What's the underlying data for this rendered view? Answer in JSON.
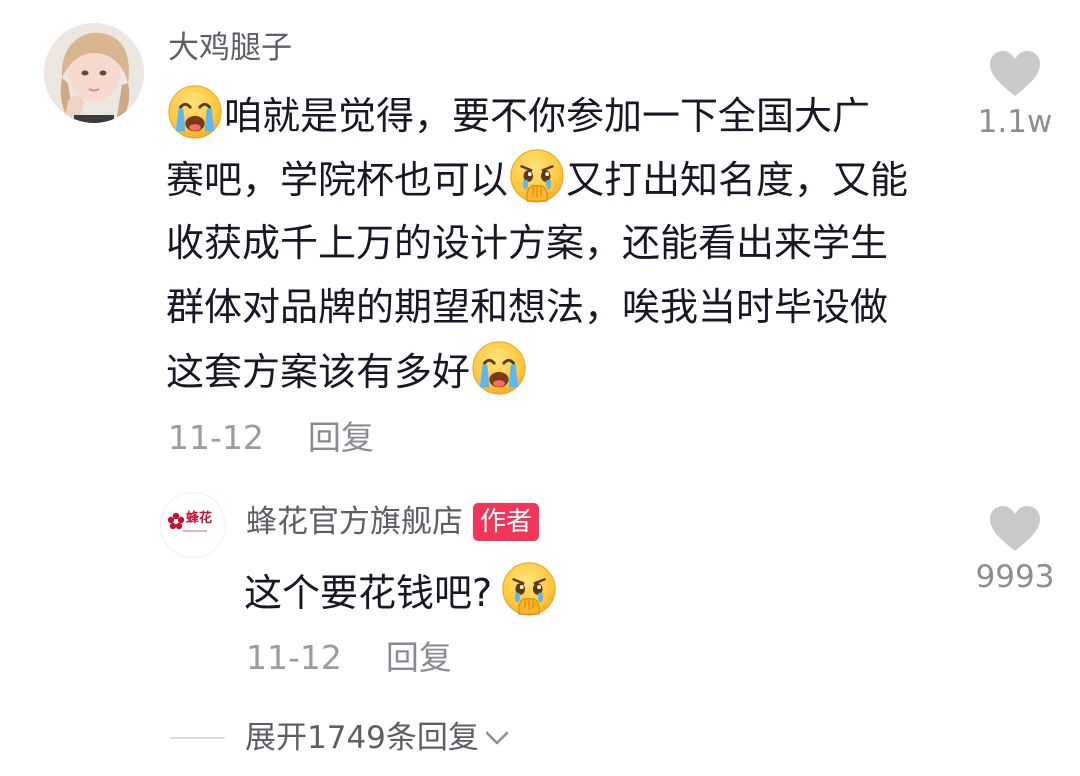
{
  "main_comment": {
    "username": "大鸡腿子",
    "lines": [
      "咱就是觉得，要不你参加一下全国大广",
      "赛吧，学院杯也可以",
      "又打出知名度，又能",
      "收获成千上万的设计方案，还能看出来学生",
      "群体对品牌的期望和想法，唉我当时毕设做",
      "这套方案该有多好"
    ],
    "date": "11-12",
    "reply_label": "回复",
    "like_count": "1.1w",
    "emojis": [
      "crying-face-emoji",
      "holding-back-tears-emoji",
      "crying-face-emoji"
    ]
  },
  "reply": {
    "username": "蜂花官方旗舰店",
    "author_badge": "作者",
    "avatar_text": "蜂花",
    "text": "这个要花钱吧?",
    "date": "11-12",
    "reply_label": "回复",
    "like_count": "9993",
    "emojis": [
      "holding-back-tears-emoji"
    ]
  },
  "expand": {
    "label": "展开1749条回复"
  },
  "colors": {
    "text_primary": "#161823",
    "text_secondary": "#5e5e66",
    "text_meta": "#9b9ba1",
    "badge_bg": "#f2365a",
    "heart": "#c9c9cc",
    "emoji_yellow": "#ffc83d"
  }
}
